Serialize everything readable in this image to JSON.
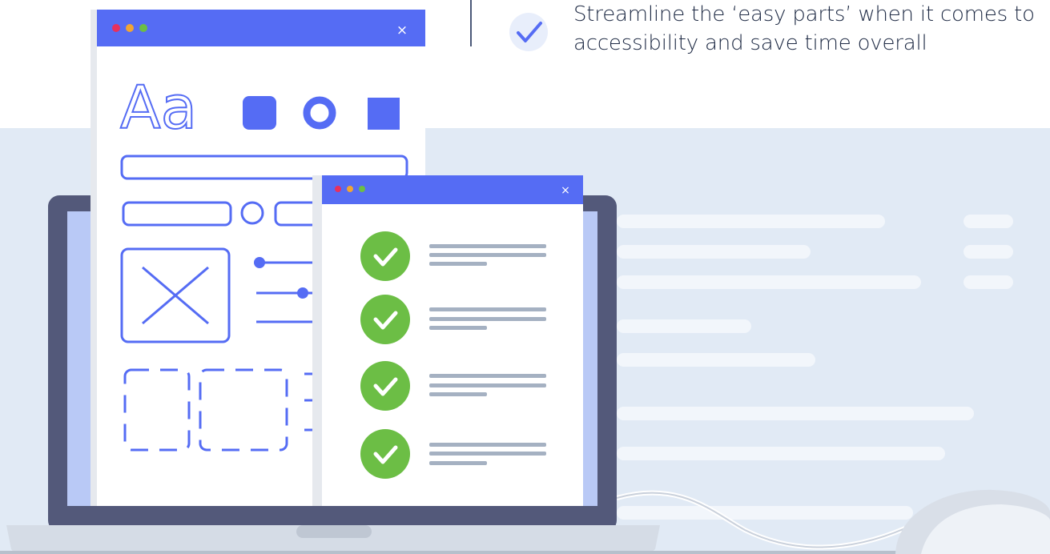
{
  "feature": {
    "text": "Streamline the ‘easy parts’ when it comes to accessibility and save time overall",
    "icon": "checkmark-icon"
  },
  "illustration": {
    "back_window": {
      "title_text": "Aa",
      "close_glyph": "×"
    },
    "front_window": {
      "close_glyph": "×",
      "checklist_count": 4
    }
  },
  "colors": {
    "accent": "#556cf4",
    "check_green": "#6cbe45",
    "band": "#e1eaf5",
    "laptop": "#53597a",
    "text": "#1e2a44"
  }
}
